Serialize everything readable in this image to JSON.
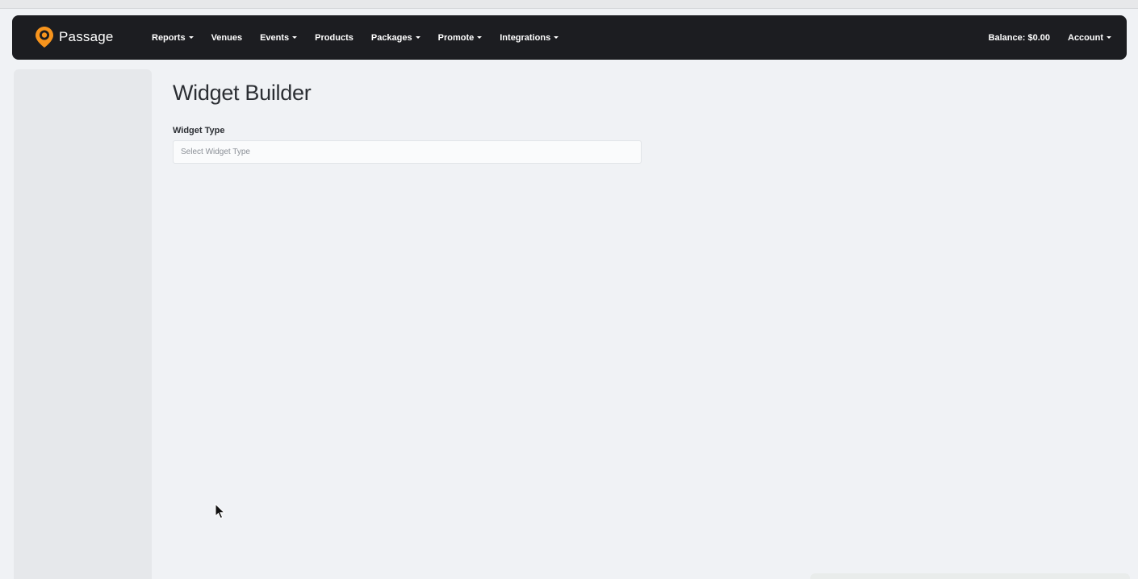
{
  "brand": {
    "name": "Passage",
    "icon": "passage-logo-icon",
    "accent": "#f7941d"
  },
  "nav": {
    "items": [
      {
        "label": "Reports",
        "dropdown": true
      },
      {
        "label": "Venues",
        "dropdown": false
      },
      {
        "label": "Events",
        "dropdown": true
      },
      {
        "label": "Products",
        "dropdown": false
      },
      {
        "label": "Packages",
        "dropdown": true
      },
      {
        "label": "Promote",
        "dropdown": true
      },
      {
        "label": "Integrations",
        "dropdown": true
      }
    ],
    "balance": "Balance: $0.00",
    "account": "Account"
  },
  "page": {
    "title": "Widget Builder",
    "widget_type": {
      "label": "Widget Type",
      "placeholder": "Select Widget Type"
    }
  },
  "colors": {
    "navbar_bg": "#1c1d21",
    "page_bg": "#f0f2f5",
    "sidebar_bg": "#e6e8eb"
  }
}
